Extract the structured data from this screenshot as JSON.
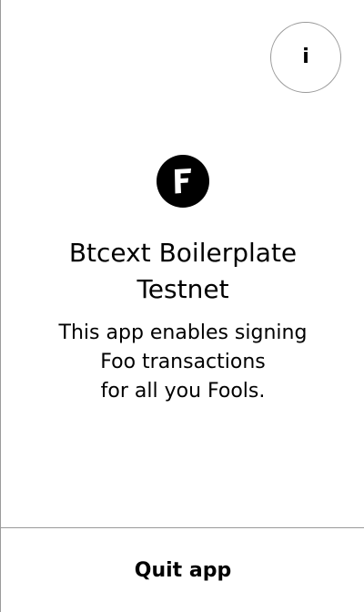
{
  "header": {
    "info_button": {
      "icon": "info-icon",
      "glyph": "i"
    }
  },
  "app": {
    "logo_icon": "app-logo-icon",
    "logo_letter": "F",
    "name": "Btcext Boilerplate\nTestnet",
    "description": "This app enables signing\nFoo transactions\nfor all you Fools."
  },
  "footer": {
    "quit_label": "Quit app"
  },
  "colors": {
    "background": "#ffffff",
    "text": "#000000",
    "border": "#9a9a9a",
    "logo_background": "#000000",
    "logo_letter": "#ffffff"
  }
}
